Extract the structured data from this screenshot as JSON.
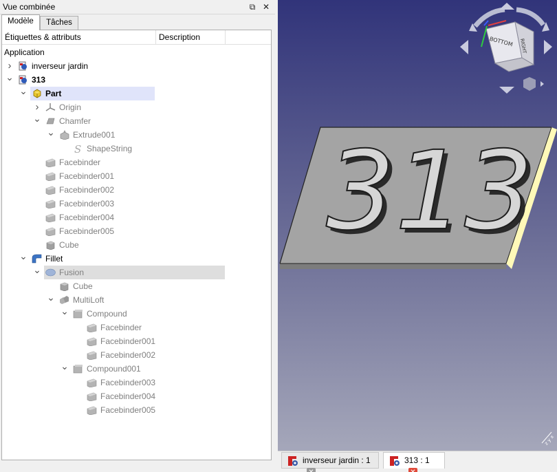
{
  "panel": {
    "title": "Vue combinée",
    "float_icon": "⧉",
    "close_icon": "✕",
    "tabs": [
      "Modèle",
      "Tâches"
    ],
    "columns": [
      "Étiquettes & attributs",
      "Description"
    ]
  },
  "tree": [
    {
      "label": "Application",
      "level": 0,
      "arrow": "",
      "icon": "none",
      "bold": false,
      "gray": false,
      "state": ""
    },
    {
      "label": "inverseur jardin",
      "level": 0,
      "arrow": "closed",
      "icon": "document",
      "bold": false,
      "gray": false,
      "state": ""
    },
    {
      "label": "313",
      "level": 0,
      "arrow": "open",
      "icon": "document",
      "bold": true,
      "gray": false,
      "state": ""
    },
    {
      "label": "Part",
      "level": 1,
      "arrow": "open",
      "icon": "part",
      "bold": true,
      "gray": false,
      "state": "selected"
    },
    {
      "label": "Origin",
      "level": 2,
      "arrow": "closed",
      "icon": "origin",
      "bold": false,
      "gray": true,
      "state": ""
    },
    {
      "label": "Chamfer",
      "level": 2,
      "arrow": "open",
      "icon": "chamfer",
      "bold": false,
      "gray": true,
      "state": ""
    },
    {
      "label": "Extrude001",
      "level": 3,
      "arrow": "open",
      "icon": "extrude",
      "bold": false,
      "gray": true,
      "state": ""
    },
    {
      "label": "ShapeString",
      "level": 4,
      "arrow": "",
      "icon": "shapestring",
      "bold": false,
      "gray": true,
      "state": ""
    },
    {
      "label": "Facebinder",
      "level": 2,
      "arrow": "",
      "icon": "facebinder",
      "bold": false,
      "gray": true,
      "state": ""
    },
    {
      "label": "Facebinder001",
      "level": 2,
      "arrow": "",
      "icon": "facebinder",
      "bold": false,
      "gray": true,
      "state": ""
    },
    {
      "label": "Facebinder002",
      "level": 2,
      "arrow": "",
      "icon": "facebinder",
      "bold": false,
      "gray": true,
      "state": ""
    },
    {
      "label": "Facebinder003",
      "level": 2,
      "arrow": "",
      "icon": "facebinder",
      "bold": false,
      "gray": true,
      "state": ""
    },
    {
      "label": "Facebinder004",
      "level": 2,
      "arrow": "",
      "icon": "facebinder",
      "bold": false,
      "gray": true,
      "state": ""
    },
    {
      "label": "Facebinder005",
      "level": 2,
      "arrow": "",
      "icon": "facebinder",
      "bold": false,
      "gray": true,
      "state": ""
    },
    {
      "label": "Cube",
      "level": 2,
      "arrow": "",
      "icon": "cube",
      "bold": false,
      "gray": true,
      "state": ""
    },
    {
      "label": "Fillet",
      "level": 1,
      "arrow": "open",
      "icon": "fillet",
      "bold": false,
      "gray": false,
      "state": ""
    },
    {
      "label": "Fusion",
      "level": 2,
      "arrow": "open",
      "icon": "fusion",
      "bold": false,
      "gray": true,
      "state": "highlight"
    },
    {
      "label": "Cube",
      "level": 3,
      "arrow": "",
      "icon": "cube",
      "bold": false,
      "gray": true,
      "state": ""
    },
    {
      "label": "MultiLoft",
      "level": 3,
      "arrow": "open",
      "icon": "multiloft",
      "bold": false,
      "gray": true,
      "state": ""
    },
    {
      "label": "Compound",
      "level": 4,
      "arrow": "open",
      "icon": "compound",
      "bold": false,
      "gray": true,
      "state": ""
    },
    {
      "label": "Facebinder",
      "level": 5,
      "arrow": "",
      "icon": "facebinder",
      "bold": false,
      "gray": true,
      "state": ""
    },
    {
      "label": "Facebinder001",
      "level": 5,
      "arrow": "",
      "icon": "facebinder",
      "bold": false,
      "gray": true,
      "state": ""
    },
    {
      "label": "Facebinder002",
      "level": 5,
      "arrow": "",
      "icon": "facebinder",
      "bold": false,
      "gray": true,
      "state": ""
    },
    {
      "label": "Compound001",
      "level": 4,
      "arrow": "open",
      "icon": "compound",
      "bold": false,
      "gray": true,
      "state": ""
    },
    {
      "label": "Facebinder003",
      "level": 5,
      "arrow": "",
      "icon": "facebinder",
      "bold": false,
      "gray": true,
      "state": ""
    },
    {
      "label": "Facebinder004",
      "level": 5,
      "arrow": "",
      "icon": "facebinder",
      "bold": false,
      "gray": true,
      "state": ""
    },
    {
      "label": "Facebinder005",
      "level": 5,
      "arrow": "",
      "icon": "facebinder",
      "bold": false,
      "gray": true,
      "state": ""
    }
  ],
  "view": {
    "engraving_text": "313",
    "navcube": {
      "front_face": "BOTTOM",
      "side_face": "RIGHT"
    },
    "axis_label": "z y x",
    "colors": {
      "bg_top": "#31347a",
      "bg_bottom": "#a5a7ba",
      "plate": "#a6a6a6",
      "edge_highlight": "#fffbc0"
    }
  },
  "document_tabs": [
    {
      "label": "inverseur jardin : 1",
      "active": false
    },
    {
      "label": "313 : 1",
      "active": true
    }
  ]
}
